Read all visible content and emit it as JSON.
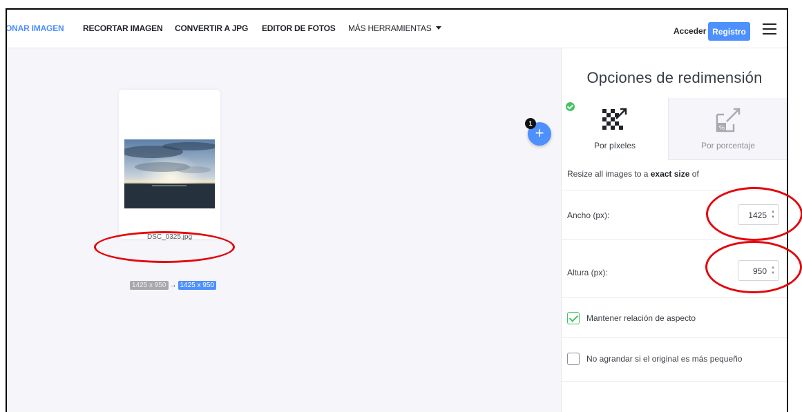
{
  "nav": {
    "items": [
      {
        "label": "ONAR IMAGEN",
        "active": true
      },
      {
        "label": "RECORTAR IMAGEN",
        "active": false
      },
      {
        "label": "CONVERTIR A JPG",
        "active": false
      },
      {
        "label": "EDITOR DE FOTOS",
        "active": false
      },
      {
        "label": "MÁS HERRAMIENTAS",
        "active": false,
        "has_dropdown": true
      }
    ],
    "login_label": "Acceder",
    "register_label": "Registro",
    "menu_icon": "hamburger-menu-icon"
  },
  "workspace": {
    "add_badge_count": "1",
    "add_icon": "+",
    "file": {
      "name": "DSC_0325.jpg",
      "original_size": "1425 x 950",
      "arrow": "→",
      "new_size": "1425 x 950"
    }
  },
  "sidebar": {
    "title": "Opciones de redimensión",
    "tabs": [
      {
        "label": "Por píxeles",
        "icon": "resize-pixels-icon",
        "selected": true
      },
      {
        "label": "Por porcentaje",
        "icon": "resize-percentage-icon",
        "selected": false
      }
    ],
    "info_prefix": "Resize all images to a",
    "info_bold": "exact size",
    "info_suffix": "of",
    "width": {
      "label": "Ancho (px):",
      "value": "1425"
    },
    "height": {
      "label": "Altura (px):",
      "value": "950"
    },
    "spinner_up": "▲",
    "spinner_down": "▼",
    "keep_ratio": {
      "label": "Mantener relación de aspecto",
      "checked": true
    },
    "no_enlarge": {
      "label": "No agrandar si el original es más pequeño",
      "checked": false
    }
  },
  "colors": {
    "accent": "#4d90fe",
    "success": "#47c265",
    "annotation": "#e3070d"
  }
}
